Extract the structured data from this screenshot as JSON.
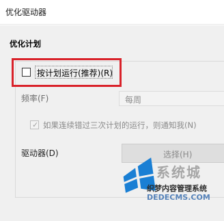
{
  "window": {
    "title": "优化驱动器"
  },
  "section": {
    "heading": "优化计划"
  },
  "schedule": {
    "run_on_schedule_label": "按计划运行(推荐)(R)",
    "run_on_schedule_checked": false
  },
  "frequency": {
    "label": "频率(F)",
    "value": "每周"
  },
  "notify": {
    "label": "如果连续错过三次计划的运行，则通知我(N)",
    "checked": true
  },
  "drives": {
    "label": "驱动器(D)",
    "choose_button_label": "选择(H)"
  },
  "watermark": {
    "big_text": "系统城",
    "small_text": "织梦内容管理系统",
    "url_text": "DEDECMS.COM",
    "logo_icon": "windows-logo-icon"
  },
  "colors": {
    "highlight_border": "#d9222a",
    "dialog_background": "#f0f0f0",
    "watermark_logo": "#1a7fd4"
  }
}
